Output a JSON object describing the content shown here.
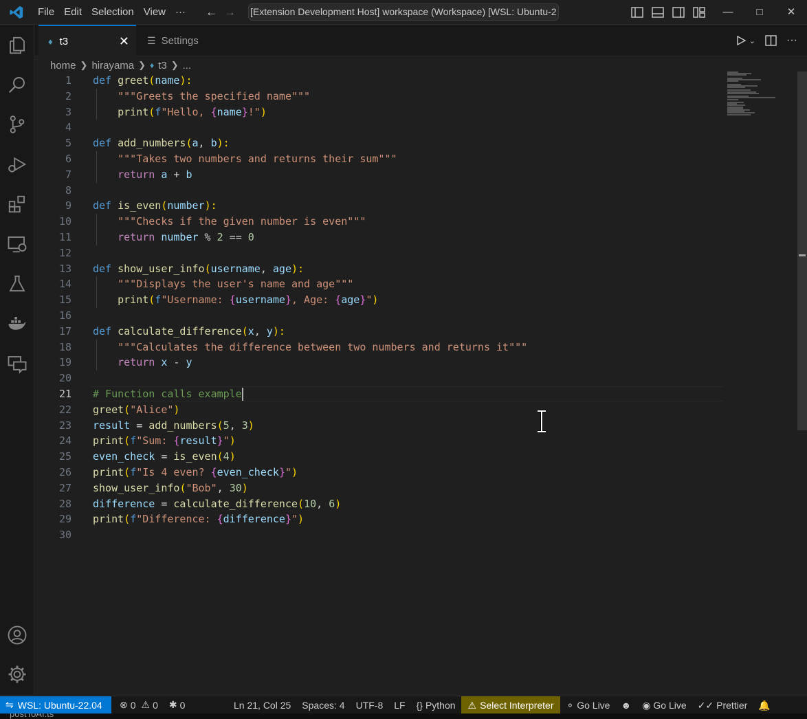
{
  "window": {
    "title": "[Extension Development Host] workspace (Workspace) [WSL: Ubuntu-2",
    "menu": [
      "File",
      "Edit",
      "Selection",
      "View",
      "···"
    ],
    "controls": [
      "—",
      "□",
      "✕"
    ]
  },
  "tabs": [
    {
      "label": "t3",
      "active": true
    },
    {
      "label": "Settings",
      "active": false
    }
  ],
  "breadcrumb": [
    "home",
    "hirayama",
    "t3",
    "..."
  ],
  "editor": {
    "current_line": 21,
    "lines": [
      {
        "n": "1"
      },
      {
        "n": "2"
      },
      {
        "n": "3"
      },
      {
        "n": "4"
      },
      {
        "n": "5"
      },
      {
        "n": "6"
      },
      {
        "n": "7"
      },
      {
        "n": "8"
      },
      {
        "n": "9"
      },
      {
        "n": "10"
      },
      {
        "n": "11"
      },
      {
        "n": "12"
      },
      {
        "n": "13"
      },
      {
        "n": "14"
      },
      {
        "n": "15"
      },
      {
        "n": "16"
      },
      {
        "n": "17"
      },
      {
        "n": "18"
      },
      {
        "n": "19"
      },
      {
        "n": "20"
      },
      {
        "n": "21"
      },
      {
        "n": "22"
      },
      {
        "n": "23"
      },
      {
        "n": "24"
      },
      {
        "n": "25"
      },
      {
        "n": "26"
      },
      {
        "n": "27"
      },
      {
        "n": "28"
      },
      {
        "n": "29"
      },
      {
        "n": "30"
      }
    ],
    "code": [
      [
        [
          "def",
          "kw"
        ],
        [
          " ",
          "txt"
        ],
        [
          "greet",
          "fn"
        ],
        [
          "(",
          "b1"
        ],
        [
          "name",
          "par"
        ],
        [
          "):",
          "b1"
        ]
      ],
      [
        [
          "    ",
          "txt"
        ],
        [
          "\"\"\"Greets the specified name\"\"\"",
          "str"
        ]
      ],
      [
        [
          "    ",
          "txt"
        ],
        [
          "print",
          "fn"
        ],
        [
          "(",
          "b1"
        ],
        [
          "f",
          "kw"
        ],
        [
          "\"Hello, ",
          "str"
        ],
        [
          "{",
          "b2"
        ],
        [
          "name",
          "par"
        ],
        [
          "}",
          "b2"
        ],
        [
          "!\"",
          "str"
        ],
        [
          ")",
          "b1"
        ]
      ],
      [],
      [
        [
          "def",
          "kw"
        ],
        [
          " ",
          "txt"
        ],
        [
          "add_numbers",
          "fn"
        ],
        [
          "(",
          "b1"
        ],
        [
          "a",
          "par"
        ],
        [
          ", ",
          "txt"
        ],
        [
          "b",
          "par"
        ],
        [
          "):",
          "b1"
        ]
      ],
      [
        [
          "    ",
          "txt"
        ],
        [
          "\"\"\"Takes two numbers and returns their sum\"\"\"",
          "str"
        ]
      ],
      [
        [
          "    ",
          "txt"
        ],
        [
          "return",
          "ctl"
        ],
        [
          " ",
          "txt"
        ],
        [
          "a",
          "par"
        ],
        [
          " + ",
          "txt"
        ],
        [
          "b",
          "par"
        ]
      ],
      [],
      [
        [
          "def",
          "kw"
        ],
        [
          " ",
          "txt"
        ],
        [
          "is_even",
          "fn"
        ],
        [
          "(",
          "b1"
        ],
        [
          "number",
          "par"
        ],
        [
          "):",
          "b1"
        ]
      ],
      [
        [
          "    ",
          "txt"
        ],
        [
          "\"\"\"Checks if the given number is even\"\"\"",
          "str"
        ]
      ],
      [
        [
          "    ",
          "txt"
        ],
        [
          "return",
          "ctl"
        ],
        [
          " ",
          "txt"
        ],
        [
          "number",
          "par"
        ],
        [
          " % ",
          "txt"
        ],
        [
          "2",
          "num"
        ],
        [
          " == ",
          "txt"
        ],
        [
          "0",
          "num"
        ]
      ],
      [],
      [
        [
          "def",
          "kw"
        ],
        [
          " ",
          "txt"
        ],
        [
          "show_user_info",
          "fn"
        ],
        [
          "(",
          "b1"
        ],
        [
          "username",
          "par"
        ],
        [
          ", ",
          "txt"
        ],
        [
          "age",
          "par"
        ],
        [
          "):",
          "b1"
        ]
      ],
      [
        [
          "    ",
          "txt"
        ],
        [
          "\"\"\"Displays the user's name and age\"\"\"",
          "str"
        ]
      ],
      [
        [
          "    ",
          "txt"
        ],
        [
          "print",
          "fn"
        ],
        [
          "(",
          "b1"
        ],
        [
          "f",
          "kw"
        ],
        [
          "\"Username: ",
          "str"
        ],
        [
          "{",
          "b2"
        ],
        [
          "username",
          "par"
        ],
        [
          "}",
          "b2"
        ],
        [
          ", Age: ",
          "str"
        ],
        [
          "{",
          "b2"
        ],
        [
          "age",
          "par"
        ],
        [
          "}",
          "b2"
        ],
        [
          "\"",
          "str"
        ],
        [
          ")",
          "b1"
        ]
      ],
      [],
      [
        [
          "def",
          "kw"
        ],
        [
          " ",
          "txt"
        ],
        [
          "calculate_difference",
          "fn"
        ],
        [
          "(",
          "b1"
        ],
        [
          "x",
          "par"
        ],
        [
          ", ",
          "txt"
        ],
        [
          "y",
          "par"
        ],
        [
          "):",
          "b1"
        ]
      ],
      [
        [
          "    ",
          "txt"
        ],
        [
          "\"\"\"Calculates the difference between two numbers and returns it\"\"\"",
          "str"
        ]
      ],
      [
        [
          "    ",
          "txt"
        ],
        [
          "return",
          "ctl"
        ],
        [
          " ",
          "txt"
        ],
        [
          "x",
          "par"
        ],
        [
          " - ",
          "txt"
        ],
        [
          "y",
          "par"
        ]
      ],
      [],
      [
        [
          "# Function calls example",
          "cm"
        ]
      ],
      [
        [
          "greet",
          "fn"
        ],
        [
          "(",
          "b1"
        ],
        [
          "\"Alice\"",
          "str"
        ],
        [
          ")",
          "b1"
        ]
      ],
      [
        [
          "result",
          "par"
        ],
        [
          " = ",
          "txt"
        ],
        [
          "add_numbers",
          "fn"
        ],
        [
          "(",
          "b1"
        ],
        [
          "5",
          "num"
        ],
        [
          ", ",
          "txt"
        ],
        [
          "3",
          "num"
        ],
        [
          ")",
          "b1"
        ]
      ],
      [
        [
          "print",
          "fn"
        ],
        [
          "(",
          "b1"
        ],
        [
          "f",
          "kw"
        ],
        [
          "\"Sum: ",
          "str"
        ],
        [
          "{",
          "b2"
        ],
        [
          "result",
          "par"
        ],
        [
          "}",
          "b2"
        ],
        [
          "\"",
          "str"
        ],
        [
          ")",
          "b1"
        ]
      ],
      [
        [
          "even_check",
          "par"
        ],
        [
          " = ",
          "txt"
        ],
        [
          "is_even",
          "fn"
        ],
        [
          "(",
          "b1"
        ],
        [
          "4",
          "num"
        ],
        [
          ")",
          "b1"
        ]
      ],
      [
        [
          "print",
          "fn"
        ],
        [
          "(",
          "b1"
        ],
        [
          "f",
          "kw"
        ],
        [
          "\"Is 4 even? ",
          "str"
        ],
        [
          "{",
          "b2"
        ],
        [
          "even_check",
          "par"
        ],
        [
          "}",
          "b2"
        ],
        [
          "\"",
          "str"
        ],
        [
          ")",
          "b1"
        ]
      ],
      [
        [
          "show_user_info",
          "fn"
        ],
        [
          "(",
          "b1"
        ],
        [
          "\"Bob\"",
          "str"
        ],
        [
          ", ",
          "txt"
        ],
        [
          "30",
          "num"
        ],
        [
          ")",
          "b1"
        ]
      ],
      [
        [
          "difference",
          "par"
        ],
        [
          " = ",
          "txt"
        ],
        [
          "calculate_difference",
          "fn"
        ],
        [
          "(",
          "b1"
        ],
        [
          "10",
          "num"
        ],
        [
          ", ",
          "txt"
        ],
        [
          "6",
          "num"
        ],
        [
          ")",
          "b1"
        ]
      ],
      [
        [
          "print",
          "fn"
        ],
        [
          "(",
          "b1"
        ],
        [
          "f",
          "kw"
        ],
        [
          "\"Difference: ",
          "str"
        ],
        [
          "{",
          "b2"
        ],
        [
          "difference",
          "par"
        ],
        [
          "}",
          "b2"
        ],
        [
          "\"",
          "str"
        ],
        [
          ")",
          "b1"
        ]
      ],
      []
    ]
  },
  "statusbar": {
    "remote": "WSL: Ubuntu-22.04",
    "errors": "0",
    "warnings": "0",
    "ports": "0",
    "position": "Ln 21, Col 25",
    "spaces": "Spaces: 4",
    "encoding": "UTF-8",
    "eol": "LF",
    "language": "Python",
    "interpreter": "Select Interpreter",
    "golive1": "Go Live",
    "golive2": "Go Live",
    "prettier": "Prettier"
  },
  "bottom_text": "postToAI.ts",
  "colors": {
    "accent": "#0078d4",
    "warning_bg": "#6e6100",
    "editor_bg": "#1f1f1f"
  }
}
